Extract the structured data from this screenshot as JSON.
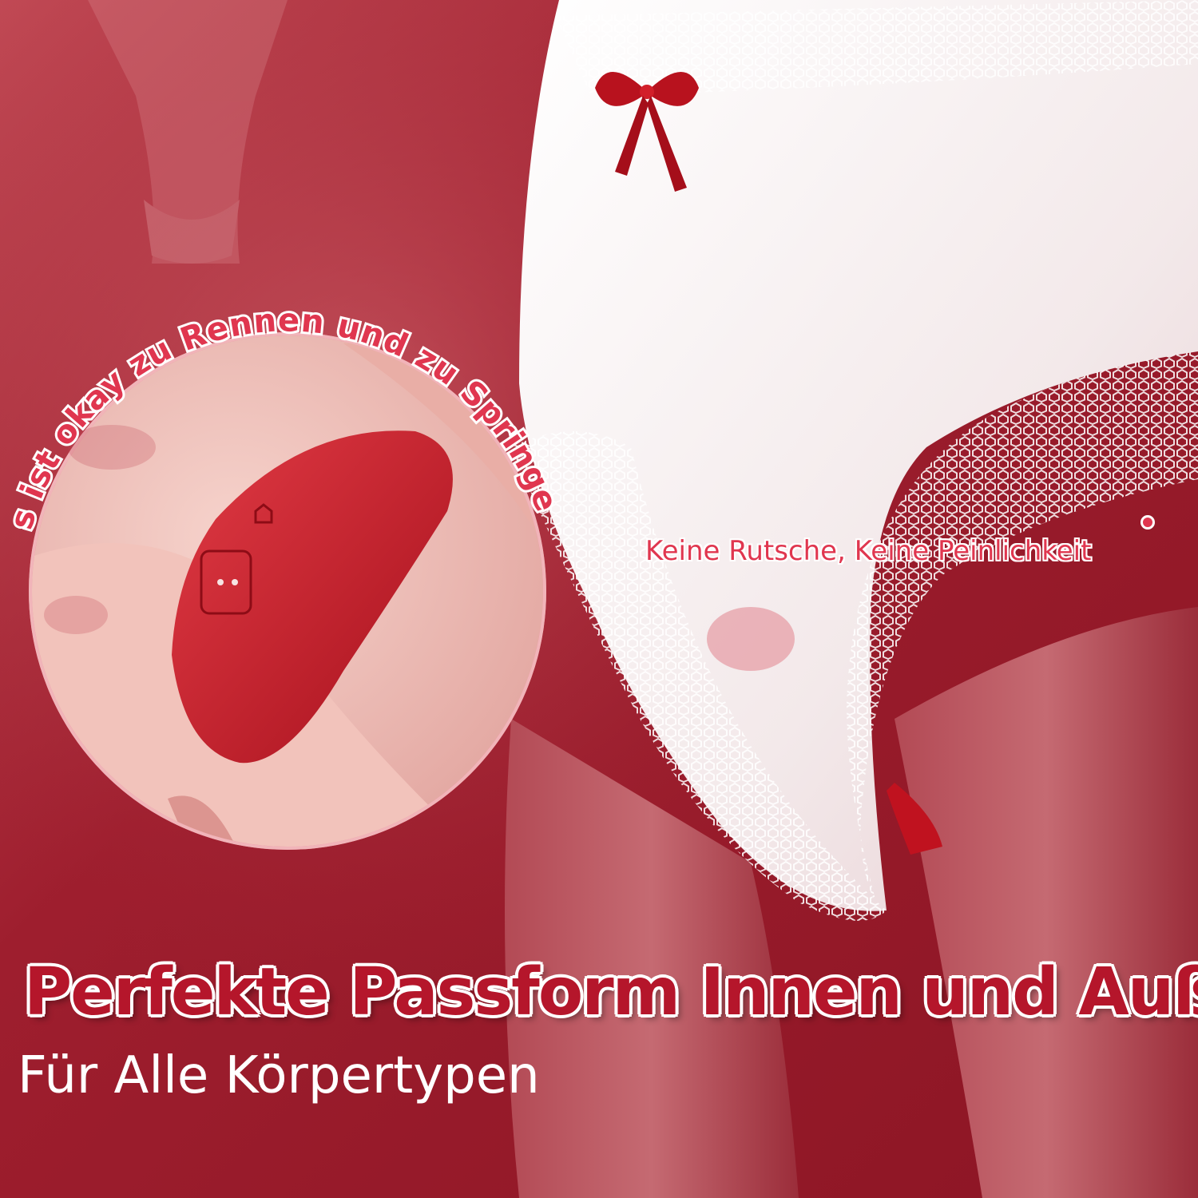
{
  "palette": {
    "background": "#9e1e2e",
    "accent": "#b5162b",
    "callout_text": "#e0364f",
    "white": "#ffffff"
  },
  "scene": {
    "description_icons": [
      "device-icon",
      "bow-icon",
      "lace-pattern"
    ]
  },
  "circle_caption": "Es ist okay zu Rennen und zu Springen",
  "callout": "Keine Rutsche, Keine Peinlichkeit",
  "headline": "Perfekte Passform Innen und Außen",
  "subline": "Für Alle Körpertypen"
}
